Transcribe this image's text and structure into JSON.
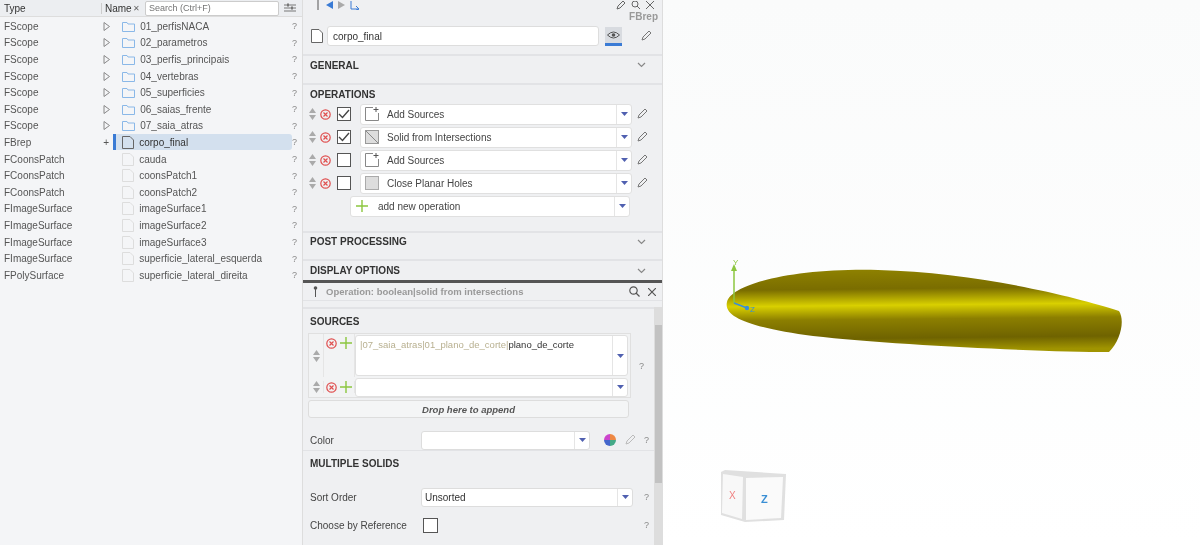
{
  "tree": {
    "columns": [
      "Type",
      "Name"
    ],
    "search": {
      "placeholder": "Search (Ctrl+F)",
      "clear": "✕"
    },
    "rows": [
      {
        "type": "FScope",
        "name": "01_perfisNACA",
        "kind": "folder",
        "expanded": false,
        "selected": false,
        "help": "?"
      },
      {
        "type": "FScope",
        "name": "02_parametros",
        "kind": "folder",
        "expanded": false,
        "selected": false,
        "help": "?"
      },
      {
        "type": "FScope",
        "name": "03_perfis_principais",
        "kind": "folder",
        "expanded": false,
        "selected": false,
        "help": "?"
      },
      {
        "type": "FScope",
        "name": "04_vertebras",
        "kind": "folder",
        "expanded": false,
        "selected": false,
        "help": "?"
      },
      {
        "type": "FScope",
        "name": "05_superficies",
        "kind": "folder",
        "expanded": false,
        "selected": false,
        "help": "?"
      },
      {
        "type": "FScope",
        "name": "06_saias_frente",
        "kind": "folder",
        "expanded": false,
        "selected": false,
        "help": "?"
      },
      {
        "type": "FScope",
        "name": "07_saia_atras",
        "kind": "folder",
        "expanded": false,
        "selected": false,
        "help": "?"
      },
      {
        "type": "FBrep",
        "name": "corpo_final",
        "kind": "brep",
        "marker": "+",
        "selected": true,
        "help": "?"
      },
      {
        "type": "FCoonsPatch",
        "name": "cauda",
        "kind": "object",
        "selected": false,
        "help": "?"
      },
      {
        "type": "FCoonsPatch",
        "name": "coonsPatch1",
        "kind": "object",
        "selected": false,
        "help": "?"
      },
      {
        "type": "FCoonsPatch",
        "name": "coonsPatch2",
        "kind": "object",
        "selected": false,
        "help": "?"
      },
      {
        "type": "FImageSurface",
        "name": "imageSurface1",
        "kind": "object",
        "selected": false,
        "help": "?"
      },
      {
        "type": "FImageSurface",
        "name": "imageSurface2",
        "kind": "object",
        "selected": false,
        "help": "?"
      },
      {
        "type": "FImageSurface",
        "name": "imageSurface3",
        "kind": "object",
        "selected": false,
        "help": "?"
      },
      {
        "type": "FImageSurface",
        "name": "superficie_lateral_esquerda",
        "kind": "object",
        "selected": false,
        "help": "?"
      },
      {
        "type": "FPolySurface",
        "name": "superficie_lateral_direita",
        "kind": "object",
        "selected": false,
        "help": "?"
      }
    ]
  },
  "editor": {
    "type_label": "FBrep",
    "name": "corpo_final",
    "visible": true,
    "general": {
      "title": "GENERAL"
    },
    "operations": {
      "title": "OPERATIONS",
      "add_label": "add new operation",
      "items": [
        {
          "label": "Add Sources",
          "kind": "sources",
          "checked": true
        },
        {
          "label": "Solid from Intersections",
          "kind": "intersection",
          "checked": true
        },
        {
          "label": "Add Sources",
          "kind": "sources",
          "checked": false
        },
        {
          "label": "Close Planar Holes",
          "kind": "holes",
          "checked": false
        }
      ]
    },
    "post_processing": {
      "title": "POST PROCESSING"
    },
    "display_options": {
      "title": "DISPLAY OPTIONS"
    }
  },
  "inspector": {
    "title": "Operation: boolean|solid from intersections",
    "sources": {
      "title": "SOURCES",
      "help": "?",
      "drop_hint": "Drop here to append",
      "items": [
        {
          "kind": "link",
          "path": "|07_saia_atras|01_plano_de_corte|",
          "leaf": "plano_de_corte"
        },
        {
          "kind": "empty"
        }
      ]
    },
    "color": {
      "label": "Color",
      "help": "?"
    },
    "multiple_solids": {
      "title": "MULTIPLE SOLIDS",
      "sort_order": {
        "label": "Sort Order",
        "value": "Unsorted",
        "help": "?"
      },
      "choose_by_reference": {
        "label": "Choose by Reference",
        "checked": false,
        "help": "?"
      }
    }
  },
  "viewport": {
    "axes": [
      "Y",
      "Z"
    ],
    "cube_faces": [
      "X",
      "Z"
    ]
  }
}
